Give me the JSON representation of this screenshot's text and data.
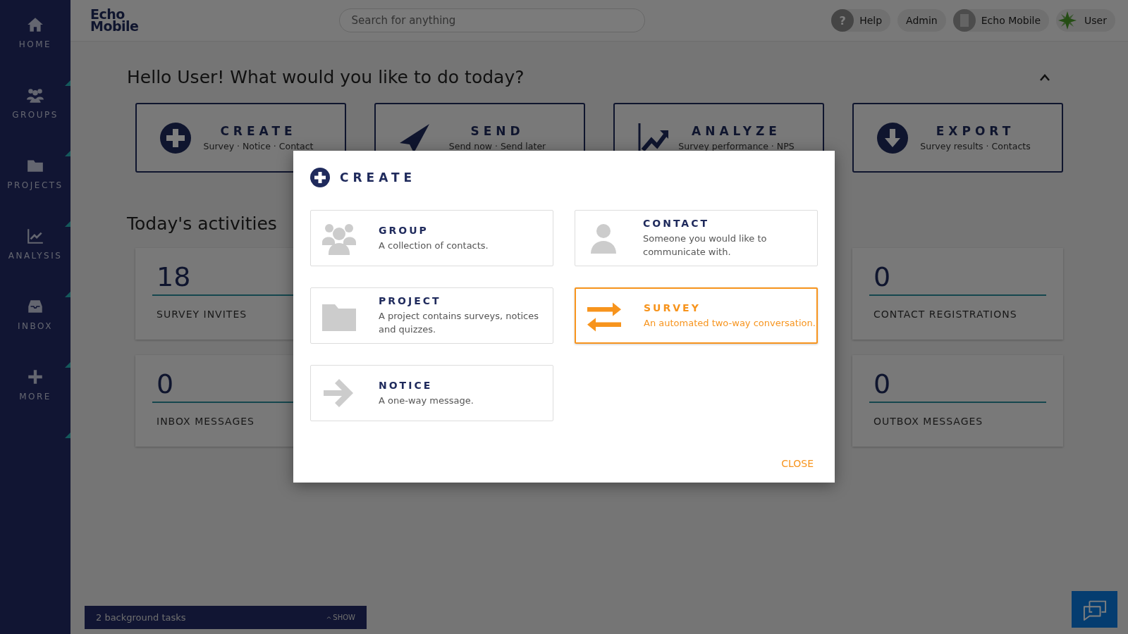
{
  "sidebar": {
    "items": [
      {
        "kind": "home",
        "label": "HOME"
      },
      {
        "kind": "groups",
        "label": "GROUPS"
      },
      {
        "kind": "projects",
        "label": "PROJECTS"
      },
      {
        "kind": "analysis",
        "label": "ANALYSIS"
      },
      {
        "kind": "inbox",
        "label": "INBOX"
      },
      {
        "kind": "more",
        "label": "MORE"
      }
    ]
  },
  "topbar": {
    "logo": [
      "Echo",
      "Mobile"
    ],
    "search": {
      "placeholder": "Search for anything"
    },
    "buttons": [
      {
        "kind": "help",
        "label": "Help",
        "icon_text": "?"
      },
      {
        "kind": "plain",
        "label": "Admin"
      },
      {
        "kind": "org",
        "label": "Echo Mobile"
      },
      {
        "kind": "user",
        "label": "User"
      }
    ]
  },
  "greeting": "Hello User! What would you like to do today?",
  "actions": [
    {
      "kind": "create",
      "title": "CREATE",
      "subtitle": "Survey · Notice · Contact"
    },
    {
      "kind": "send",
      "title": "SEND",
      "subtitle": "Send now · Send later"
    },
    {
      "kind": "analyze",
      "title": "ANALYZE",
      "subtitle": "Survey performance · NPS"
    },
    {
      "kind": "export",
      "title": "EXPORT",
      "subtitle": "Survey results · Contacts"
    }
  ],
  "activities": {
    "title": "Today's activities",
    "stats": [
      {
        "value": "18",
        "label": "SURVEY INVITES"
      },
      {
        "value": "0",
        "label": "CONTACT REGISTRATIONS"
      },
      {
        "value": "0",
        "label": "INBOX MESSAGES"
      },
      {
        "value": "0",
        "label": "OUTBOX MESSAGES"
      }
    ]
  },
  "background_tasks": {
    "label": "2 background tasks",
    "toggle": "SHOW"
  },
  "dialog": {
    "title": "CREATE",
    "options": [
      {
        "kind": "group",
        "title": "GROUP",
        "description": "A collection of contacts.",
        "selected": false
      },
      {
        "kind": "contact",
        "title": "CONTACT",
        "description": "Someone you would like to communicate with.",
        "selected": false
      },
      {
        "kind": "project",
        "title": "PROJECT",
        "description": "A project contains surveys, notices and quizzes.",
        "selected": false
      },
      {
        "kind": "survey",
        "title": "SURVEY",
        "description": "An automated two-way conversation.",
        "selected": true
      },
      {
        "kind": "notice",
        "title": "NOTICE",
        "description": "A one-way message.",
        "selected": false
      }
    ],
    "close": "CLOSE"
  }
}
